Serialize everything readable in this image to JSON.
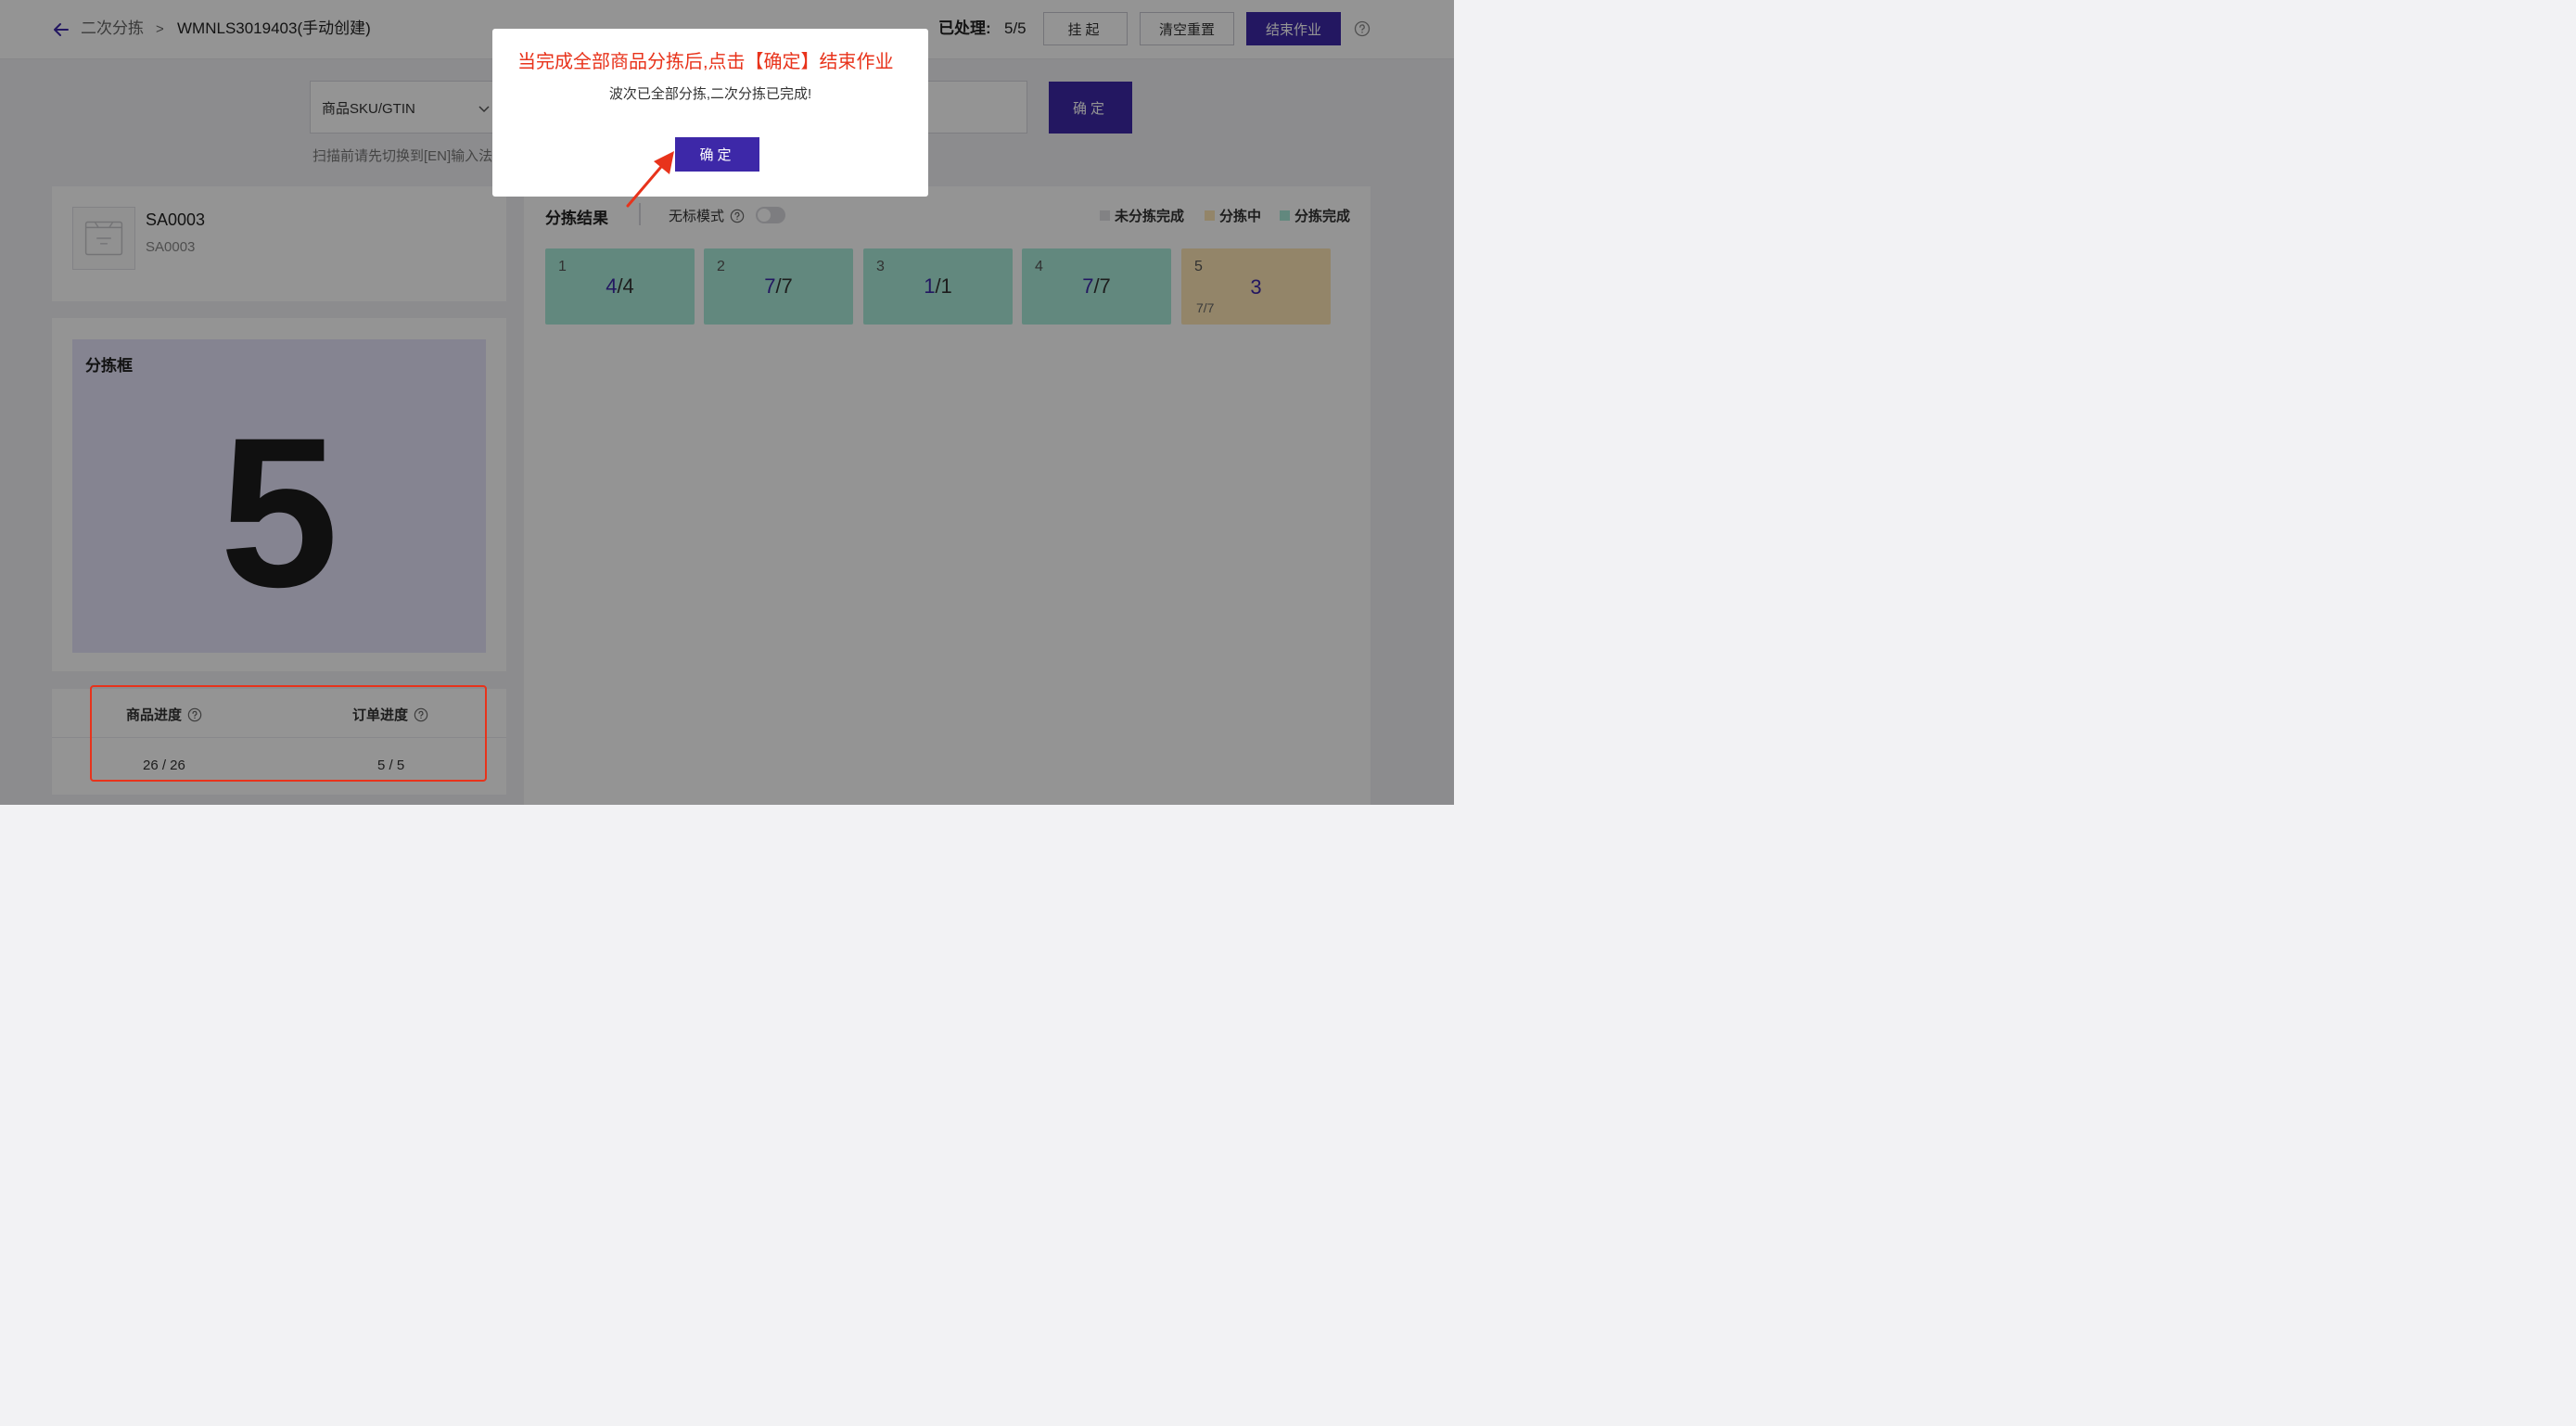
{
  "header": {
    "back_icon": "arrow-left-icon",
    "crumb_parent": "二次分拣",
    "crumb_sep": ">",
    "crumb_current": "WMNLS3019403(手动创建)",
    "processed_label": "已处理:",
    "processed_value": "5/5",
    "suspend_label": "挂起",
    "reset_label": "清空重置",
    "finish_label": "结束作业",
    "help_icon": "question-circle-icon"
  },
  "scan": {
    "select_value": "商品SKU/GTIN",
    "confirm_label": "确定",
    "hint": "扫描前请先切换到[EN]输入法"
  },
  "product": {
    "image_icon": "no-image-placeholder-icon",
    "sku": "SA0003",
    "sub": "SA0003"
  },
  "sortbox": {
    "title": "分拣框",
    "number": "5"
  },
  "progress": {
    "goods_label": "商品进度",
    "order_label": "订单进度",
    "goods_value": "26 / 26",
    "order_value": "5 / 5"
  },
  "results": {
    "title": "分拣结果",
    "unlabeled_mode": "无标模式",
    "toggle_on": false,
    "legend": {
      "pending": "未分拣完成",
      "sorting": "分拣中",
      "done": "分拣完成"
    },
    "colors": {
      "pending": "#e0e0e4",
      "sorting": "#fde6b5",
      "done": "#a9ebd9",
      "accent": "#3d28a8"
    },
    "bins": [
      {
        "index": "1",
        "current": "4",
        "total": "/4",
        "status": "done"
      },
      {
        "index": "2",
        "current": "7",
        "total": "/7",
        "status": "done"
      },
      {
        "index": "3",
        "current": "1",
        "total": "/1",
        "status": "done"
      },
      {
        "index": "4",
        "current": "7",
        "total": "/7",
        "status": "done"
      },
      {
        "index": "5",
        "big": "3",
        "small": "7/7",
        "status": "sorting"
      }
    ]
  },
  "modal": {
    "annotation": "当完成全部商品分拣后,点击【确定】结束作业",
    "message": "波次已全部分拣,二次分拣已完成!",
    "ok_label": "确定"
  }
}
